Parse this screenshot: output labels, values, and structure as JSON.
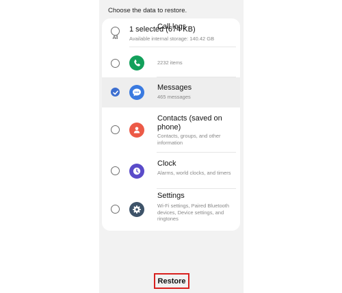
{
  "header": {
    "text": "Choose the data to restore."
  },
  "summary": {
    "title": "1 selected (674 KB)",
    "subtitle": "Available internal storage: 140.42 GB",
    "all_label": "All"
  },
  "items": [
    {
      "title": "Call logs",
      "subtitle": "2232 items",
      "icon": "phone-icon",
      "color": "#12a05b",
      "checked": false
    },
    {
      "title": "Messages",
      "subtitle": "465 messages",
      "icon": "messages-icon",
      "color": "#3a7ae0",
      "checked": true
    },
    {
      "title": "Contacts (saved on phone)",
      "subtitle": "Contacts, groups, and other information",
      "icon": "contacts-icon",
      "color": "#ec5a47",
      "checked": false
    },
    {
      "title": "Clock",
      "subtitle": "Alarms, world clocks, and timers",
      "icon": "clock-icon",
      "color": "#5a4bc9",
      "checked": false
    },
    {
      "title": "Settings",
      "subtitle": "Wi-Fi settings, Paired Bluetooth devices, Device settings, and ringtones",
      "icon": "gear-icon",
      "color": "#3e5369",
      "checked": false
    }
  ],
  "footer": {
    "restore_label": "Restore",
    "highlight_color": "#d8201e"
  },
  "colors": {
    "accent": "#3d6fd0",
    "background": "#f2f2f2"
  }
}
